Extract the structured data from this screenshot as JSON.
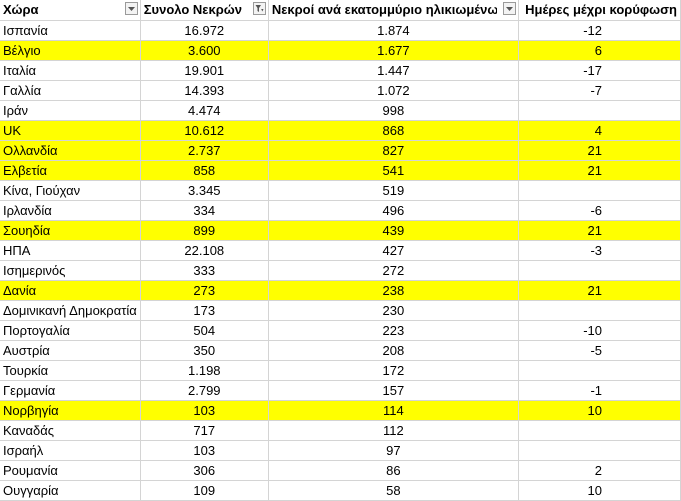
{
  "headers": [
    "Χώρα",
    "Συνολο Νεκρών",
    "Νεκροί ανά εκατομμύριο ηλικιωμένων",
    "Ημέρες μέχρι κορύφωση"
  ],
  "filter_icons": [
    "filter-dropdown-icon",
    "filter-active-icon",
    "filter-dropdown-icon"
  ],
  "highlight_color": "#ffff00",
  "rows": [
    {
      "country": "Ισπανία",
      "total": "16.972",
      "per_million": "1.874",
      "days": "-12",
      "hl": false
    },
    {
      "country": "Βέλγιο",
      "total": "3.600",
      "per_million": "1.677",
      "days": "6",
      "hl": true
    },
    {
      "country": "Ιταλία",
      "total": "19.901",
      "per_million": "1.447",
      "days": "-17",
      "hl": false
    },
    {
      "country": "Γαλλία",
      "total": "14.393",
      "per_million": "1.072",
      "days": "-7",
      "hl": false
    },
    {
      "country": "Ιράν",
      "total": "4.474",
      "per_million": "998",
      "days": "",
      "hl": false
    },
    {
      "country": "UK",
      "total": "10.612",
      "per_million": "868",
      "days": "4",
      "hl": true
    },
    {
      "country": "Ολλανδία",
      "total": "2.737",
      "per_million": "827",
      "days": "21",
      "hl": true
    },
    {
      "country": "Ελβετία",
      "total": "858",
      "per_million": "541",
      "days": "21",
      "hl": true
    },
    {
      "country": "Κίνα, Γιούχαν",
      "total": "3.345",
      "per_million": "519",
      "days": "",
      "hl": false
    },
    {
      "country": "Ιρλανδία",
      "total": "334",
      "per_million": "496",
      "days": "-6",
      "hl": false
    },
    {
      "country": "Σουηδία",
      "total": "899",
      "per_million": "439",
      "days": "21",
      "hl": true
    },
    {
      "country": "ΗΠΑ",
      "total": "22.108",
      "per_million": "427",
      "days": "-3",
      "hl": false
    },
    {
      "country": "Ισημερινός",
      "total": "333",
      "per_million": "272",
      "days": "",
      "hl": false
    },
    {
      "country": "Δανία",
      "total": "273",
      "per_million": "238",
      "days": "21",
      "hl": true
    },
    {
      "country": "Δομινικανή Δημοκρατία",
      "total": "173",
      "per_million": "230",
      "days": "",
      "hl": false
    },
    {
      "country": "Πορτογαλία",
      "total": "504",
      "per_million": "223",
      "days": "-10",
      "hl": false
    },
    {
      "country": "Αυστρία",
      "total": "350",
      "per_million": "208",
      "days": "-5",
      "hl": false
    },
    {
      "country": "Τουρκία",
      "total": "1.198",
      "per_million": "172",
      "days": "",
      "hl": false
    },
    {
      "country": "Γερμανία",
      "total": "2.799",
      "per_million": "157",
      "days": "-1",
      "hl": false
    },
    {
      "country": "Νορβηγία",
      "total": "103",
      "per_million": "114",
      "days": "10",
      "hl": true
    },
    {
      "country": "Καναδάς",
      "total": "717",
      "per_million": "112",
      "days": "",
      "hl": false
    },
    {
      "country": "Ισραήλ",
      "total": "103",
      "per_million": "97",
      "days": "",
      "hl": false
    },
    {
      "country": "Ρουμανία",
      "total": "306",
      "per_million": "86",
      "days": "2",
      "hl": false
    },
    {
      "country": "Ουγγαρία",
      "total": "109",
      "per_million": "58",
      "days": "10",
      "hl": false
    }
  ]
}
